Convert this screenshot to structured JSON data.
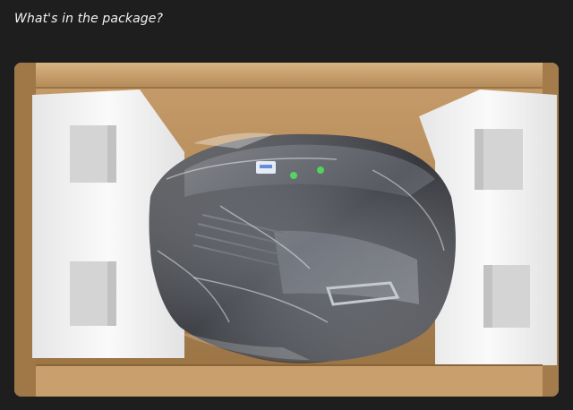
{
  "page": {
    "heading": "What's in the package?"
  },
  "photo": {
    "subject": "unboxed-product-in-cardboard-box",
    "colors": {
      "background": "#1e1e1e",
      "cardboard": "#b48c5e",
      "foam": "#f2f2f2",
      "product": "#3a3d44",
      "indicator": "#2ecc40"
    }
  }
}
